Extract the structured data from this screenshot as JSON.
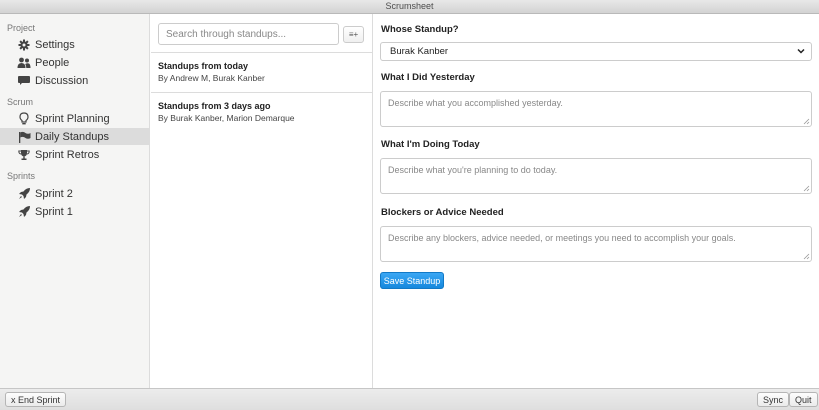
{
  "window": {
    "title": "Scrumsheet"
  },
  "sidebar": {
    "sections": [
      {
        "label": "Project",
        "items": [
          {
            "label": "Settings",
            "icon": "gear-icon",
            "active": false
          },
          {
            "label": "People",
            "icon": "people-icon",
            "active": false
          },
          {
            "label": "Discussion",
            "icon": "chat-icon",
            "active": false
          }
        ]
      },
      {
        "label": "Scrum",
        "items": [
          {
            "label": "Sprint Planning",
            "icon": "lightbulb-icon",
            "active": false
          },
          {
            "label": "Daily Standups",
            "icon": "flag-icon",
            "active": true
          },
          {
            "label": "Sprint Retros",
            "icon": "trophy-icon",
            "active": false
          }
        ]
      },
      {
        "label": "Sprints",
        "items": [
          {
            "label": "Sprint 2",
            "icon": "rocket-icon",
            "active": false
          },
          {
            "label": "Sprint 1",
            "icon": "rocket-icon",
            "active": false
          }
        ]
      }
    ]
  },
  "list": {
    "search_placeholder": "Search through standups...",
    "compose_label": "≡+",
    "standups": [
      {
        "title": "Standups from today",
        "authors": "By Andrew M, Burak Kanber"
      },
      {
        "title": "Standups from 3 days ago",
        "authors": "By Burak Kanber, Marion Demarque"
      }
    ]
  },
  "form": {
    "whose_label": "Whose Standup?",
    "whose_value": "Burak Kanber",
    "yesterday_label": "What I Did Yesterday",
    "yesterday_placeholder": "Describe what you accomplished yesterday.",
    "today_label": "What I'm Doing Today",
    "today_placeholder": "Describe what you're planning to do today.",
    "blockers_label": "Blockers or Advice Needed",
    "blockers_placeholder": "Describe any blockers, advice needed, or meetings you need to accomplish your goals.",
    "save_label": "Save Standup"
  },
  "footer": {
    "end_sprint_label": "x End Sprint",
    "sync_label": "Sync",
    "quit_label": "Quit"
  },
  "colors": {
    "accent": "#1688dd",
    "active_nav": "#dcdcdc"
  }
}
